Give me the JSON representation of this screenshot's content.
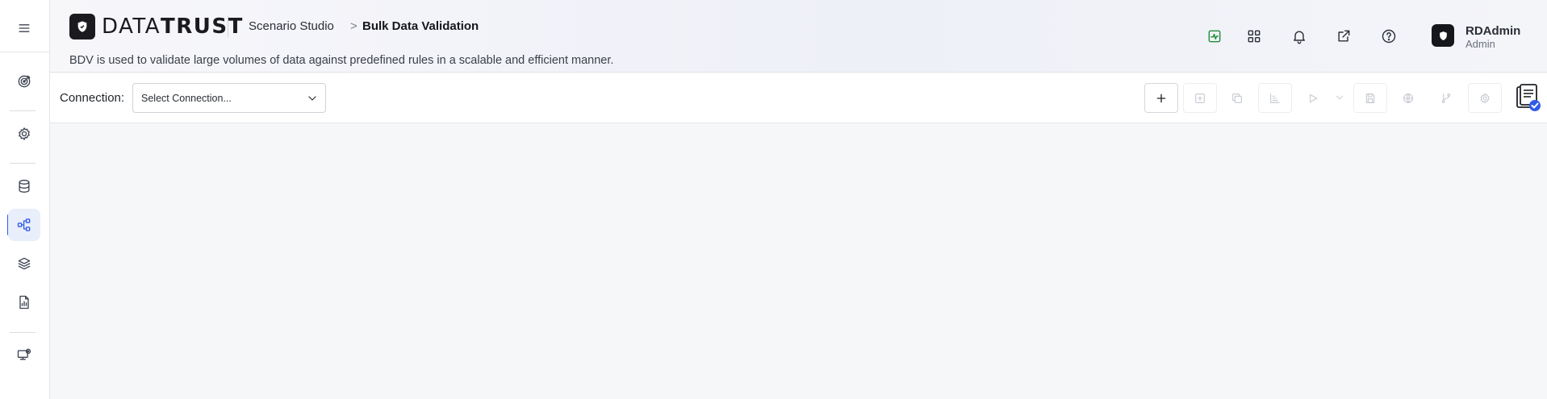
{
  "app": {
    "brand_light": "DATA",
    "brand_bold": "TRUST",
    "accent_color": "#2f5be6"
  },
  "sidebar": {
    "items": [
      {
        "name": "menu-icon",
        "active": false
      },
      {
        "name": "target-icon",
        "active": false
      },
      {
        "name": "gear-icon",
        "active": false
      },
      {
        "name": "database-icon",
        "active": false
      },
      {
        "name": "workflow-icon",
        "active": true
      },
      {
        "name": "layers-icon",
        "active": false
      },
      {
        "name": "file-report-icon",
        "active": false
      },
      {
        "name": "monitor-settings-icon",
        "active": false
      }
    ]
  },
  "header": {
    "breadcrumb": [
      "Scenario Studio",
      "Bulk Data Validation"
    ],
    "breadcrumb_separator": ">",
    "subtitle": "BDV is used to validate large volumes of data against predefined rules in a scalable and efficient manner.",
    "icons": [
      "activity-icon",
      "apps-grid-icon",
      "bell-icon",
      "external-link-icon",
      "help-icon"
    ],
    "user": {
      "name": "RDAdmin",
      "role": "Admin"
    }
  },
  "toolbar": {
    "connection_label": "Connection:",
    "connection_placeholder": "Select Connection...",
    "buttons": [
      {
        "name": "add-button",
        "icon": "plus-icon",
        "enabled": true
      },
      {
        "name": "add-box-button",
        "icon": "plus-square-icon",
        "enabled": false
      },
      {
        "name": "copy-button",
        "icon": "copy-icon",
        "enabled": false
      },
      {
        "name": "chart-button",
        "icon": "bar-chart-icon",
        "enabled": false
      },
      {
        "name": "run-button",
        "icon": "play-icon",
        "enabled": false
      },
      {
        "name": "save-button",
        "icon": "save-icon",
        "enabled": false
      },
      {
        "name": "globe-button",
        "icon": "globe-icon",
        "enabled": false
      },
      {
        "name": "branch-button",
        "icon": "git-branch-icon",
        "enabled": false
      },
      {
        "name": "settings-button",
        "icon": "gear-icon",
        "enabled": false
      },
      {
        "name": "report-button",
        "icon": "report-check-icon",
        "enabled": true
      }
    ]
  }
}
